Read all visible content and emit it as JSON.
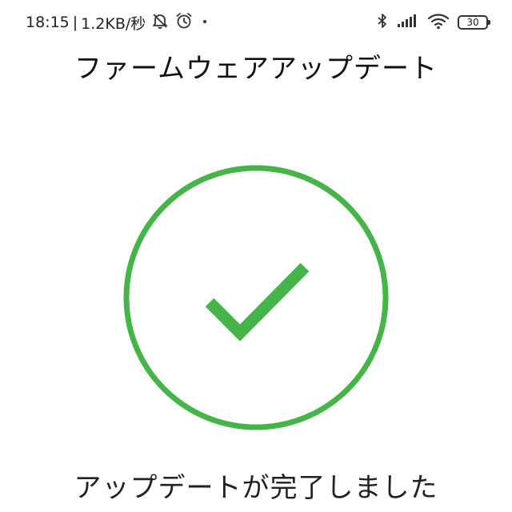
{
  "status_bar": {
    "time": "18:15",
    "separator": "|",
    "network_speed": "1.2KB/秒",
    "battery_level": "30",
    "icons": [
      "notification-muted-icon",
      "alarm-icon",
      "dot-icon",
      "bluetooth-icon",
      "cellular-signal-icon",
      "wifi-icon",
      "battery-icon"
    ]
  },
  "header": {
    "title": "ファームウェアアップデート"
  },
  "success": {
    "icon": "checkmark-circle-icon",
    "color": "#45b549"
  },
  "message": {
    "text": "アップデートが完了しました"
  }
}
